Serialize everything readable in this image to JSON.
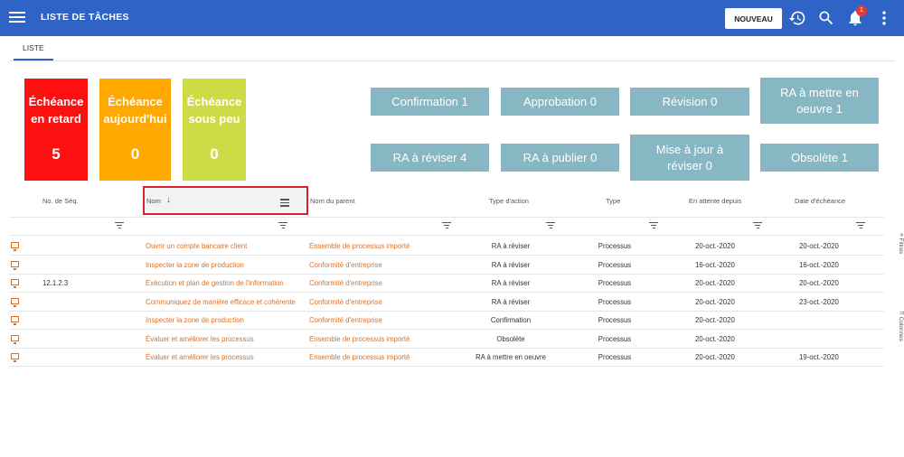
{
  "header": {
    "title": "LISTE DE TÂCHES",
    "new_label": "NOUVEAU",
    "notification_count": "1"
  },
  "tabs": [
    {
      "label": "LISTE"
    }
  ],
  "tiles": [
    {
      "label_1": "Échéance",
      "label_2": "en retard",
      "value": "5",
      "color": "#ff1010"
    },
    {
      "label_1": "Échéance",
      "label_2": "aujourd'hui",
      "value": "0",
      "color": "#ffa800"
    },
    {
      "label_1": "Échéance",
      "label_2": "sous peu",
      "value": "0",
      "color": "#cddc44"
    }
  ],
  "quick_buttons": [
    {
      "line1": "Confirmation 1",
      "line2": ""
    },
    {
      "line1": "Approbation 0",
      "line2": ""
    },
    {
      "line1": "Révision 0",
      "line2": ""
    },
    {
      "line1": "RA à mettre en",
      "line2": "oeuvre 1"
    },
    {
      "line1": "RA à réviser 4",
      "line2": ""
    },
    {
      "line1": "RA à publier 0",
      "line2": ""
    },
    {
      "line1": "Mise à jour à",
      "line2": "réviser 0"
    },
    {
      "line1": "Obsolète 1",
      "line2": ""
    }
  ],
  "table": {
    "columns": [
      "No. de Séq.",
      "Nom",
      "Nom du parent",
      "Type d'action",
      "Type",
      "En attente depuis",
      "Date d'échéance"
    ],
    "rows": [
      {
        "seq": "",
        "nom": "Ouvrir un compte bancaire client",
        "parent": "Ensemble de processus importé",
        "action": "RA à réviser",
        "type": "Processus",
        "since": "20-oct.-2020",
        "due": "20-oct.-2020"
      },
      {
        "seq": "",
        "nom": "Inspecter la zone de production",
        "parent": "Conformité d'entreprise",
        "action": "RA à réviser",
        "type": "Processus",
        "since": "16-oct.-2020",
        "due": "16-oct.-2020"
      },
      {
        "seq": "12.1.2.3",
        "nom": "Exécution et plan de gestion de l'information",
        "parent": "Conformité d'entreprise",
        "action": "RA à réviser",
        "type": "Processus",
        "since": "20-oct.-2020",
        "due": "20-oct.-2020"
      },
      {
        "seq": "",
        "nom": "Communiquez de manière efficace et cohérente",
        "parent": "Conformité d'entreprise",
        "action": "RA à réviser",
        "type": "Processus",
        "since": "20-oct.-2020",
        "due": "23-oct.-2020"
      },
      {
        "seq": "",
        "nom": "Inspecter la zone de production",
        "parent": "Conformité d'entreprise",
        "action": "Confirmation",
        "type": "Processus",
        "since": "20-oct.-2020",
        "due": ""
      },
      {
        "seq": "",
        "nom": "Évaluer et améliorer les processus",
        "parent": "Ensemble de processus importé",
        "action": "Obsolète",
        "type": "Processus",
        "since": "20-oct.-2020",
        "due": ""
      },
      {
        "seq": "",
        "nom": "Évaluer et améliorer les processus",
        "parent": "Ensemble de processus importé",
        "action": "RA à mettre en oeuvre",
        "type": "Processus",
        "since": "20-oct.-2020",
        "due": "19-oct.-2020"
      }
    ]
  },
  "side_tabs": {
    "filters": "Filtres",
    "columns": "Colonnes"
  },
  "colors": {
    "primary": "#2f63c5",
    "link": "#d8722a",
    "quick_button": "#87b7c2",
    "highlight": "#d9232a"
  }
}
